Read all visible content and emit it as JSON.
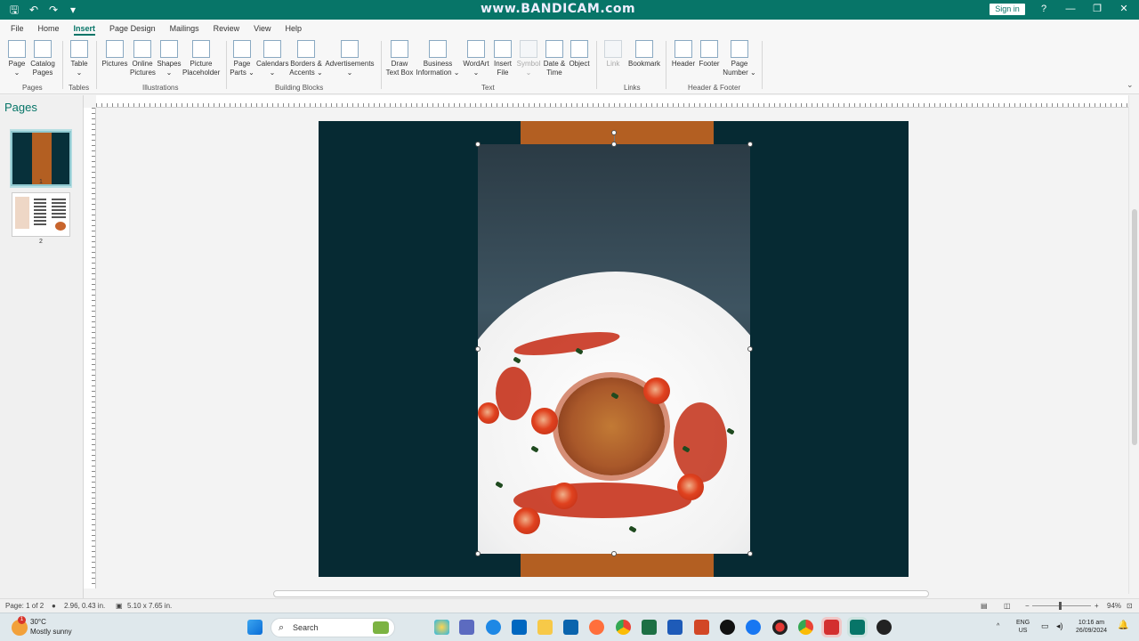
{
  "watermark": "www.BANDICAM.com",
  "titlebar": {
    "signin": "Sign in",
    "help": "?",
    "min": "—",
    "restore": "❐",
    "close": "✕"
  },
  "tabs": [
    "File",
    "Home",
    "Insert",
    "Page Design",
    "Mailings",
    "Review",
    "View",
    "Help"
  ],
  "ribbon": {
    "buttons": [
      {
        "label": "Page",
        "sub": "⌄"
      },
      {
        "label": "Catalog",
        "sub": "Pages"
      },
      {
        "label": "Table",
        "sub": "⌄"
      },
      {
        "label": "Pictures",
        "sub": ""
      },
      {
        "label": "Online",
        "sub": "Pictures"
      },
      {
        "label": "Shapes",
        "sub": "⌄"
      },
      {
        "label": "Picture",
        "sub": "Placeholder"
      },
      {
        "label": "Page",
        "sub": "Parts ⌄"
      },
      {
        "label": "Calendars",
        "sub": "⌄"
      },
      {
        "label": "Borders &",
        "sub": "Accents ⌄"
      },
      {
        "label": "Advertisements",
        "sub": "⌄"
      },
      {
        "label": "Draw",
        "sub": "Text Box"
      },
      {
        "label": "Business",
        "sub": "Information ⌄"
      },
      {
        "label": "WordArt",
        "sub": "⌄"
      },
      {
        "label": "Insert",
        "sub": "File"
      },
      {
        "label": "Symbol",
        "sub": "⌄"
      },
      {
        "label": "Date &",
        "sub": "Time"
      },
      {
        "label": "Object",
        "sub": ""
      },
      {
        "label": "Link",
        "sub": ""
      },
      {
        "label": "Bookmark",
        "sub": ""
      },
      {
        "label": "Header",
        "sub": ""
      },
      {
        "label": "Footer",
        "sub": ""
      },
      {
        "label": "Page",
        "sub": "Number ⌄"
      }
    ],
    "groups": [
      "Pages",
      "Tables",
      "Illustrations",
      "Building Blocks",
      "Text",
      "Links",
      "Header & Footer"
    ]
  },
  "pages_pane": {
    "title": "Pages",
    "page1": "1",
    "page2": "2"
  },
  "status": {
    "page": "Page: 1 of 2",
    "position": "2.96, 0.43 in.",
    "size": "5.10 x 7.65 in.",
    "zoom": "94%"
  },
  "taskbar": {
    "weather_temp": "30°C",
    "weather_desc": "Mostly sunny",
    "weather_badge": "1",
    "search": "Search",
    "lang1": "ENG",
    "lang2": "US",
    "time": "10:16 am",
    "date": "26/09/2024"
  },
  "colors": {
    "accent": "#077568",
    "page_bg": "#062a33",
    "stripe": "#b35f22"
  }
}
